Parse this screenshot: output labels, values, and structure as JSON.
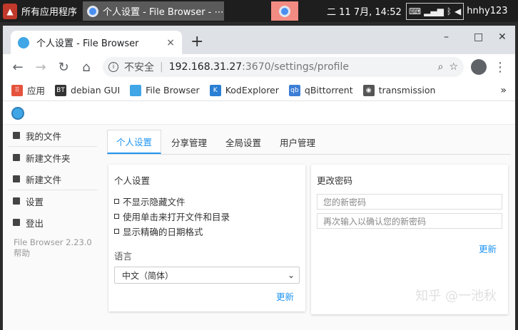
{
  "panel": {
    "apps_label": "所有应用程序",
    "task_title": "个人设置 - File Browser - ⋯",
    "clock": "二 11 7月, 14:52",
    "user": "hnhy123"
  },
  "browser": {
    "tab_title": "个人设置 - File Browser",
    "tab_close": "×",
    "new_tab": "+",
    "win_min": "–",
    "win_max": "□",
    "win_close": "✕",
    "not_secure": "不安全",
    "url_host": "192.168.31.27",
    "url_path": ":3670/settings/profile"
  },
  "bookmarks": [
    {
      "label": "应用",
      "icon": "apps-grid-icon",
      "color": "#e5533d",
      "glyph": "⠿"
    },
    {
      "label": "debian GUI",
      "icon": "bt-icon",
      "color": "#333333",
      "glyph": "BT"
    },
    {
      "label": "File Browser",
      "icon": "filebrowser-icon",
      "color": "#40a6e6",
      "glyph": ""
    },
    {
      "label": "KodExplorer",
      "icon": "kod-icon",
      "color": "#2a7fd4",
      "glyph": "K"
    },
    {
      "label": "qBittorrent",
      "icon": "qbittorrent-icon",
      "color": "#3c7ed6",
      "glyph": "qb"
    },
    {
      "label": "transmission",
      "icon": "globe-icon",
      "color": "#555555",
      "glyph": "◉"
    }
  ],
  "sidebar": {
    "items": [
      {
        "label": "我的文件",
        "icon": "folder-icon"
      },
      {
        "label": "新建文件夹",
        "icon": "folder-plus-icon"
      },
      {
        "label": "新建文件",
        "icon": "file-plus-icon"
      },
      {
        "label": "设置",
        "icon": "settings-icon"
      },
      {
        "label": "登出",
        "icon": "logout-icon"
      }
    ],
    "version": "File Browser 2.23.0",
    "help": "帮助"
  },
  "tabs": [
    {
      "label": "个人设置",
      "active": true
    },
    {
      "label": "分享管理",
      "active": false
    },
    {
      "label": "全局设置",
      "active": false
    },
    {
      "label": "用户管理",
      "active": false
    }
  ],
  "profile": {
    "title": "个人设置",
    "options": [
      "不显示隐藏文件",
      "使用单击来打开文件和目录",
      "显示精确的日期格式"
    ],
    "lang_label": "语言",
    "lang_value": "中文（简体）",
    "update": "更新"
  },
  "password": {
    "title": "更改密码",
    "new_placeholder": "您的新密码",
    "confirm_placeholder": "再次输入以确认您的新密码",
    "update": "更新"
  },
  "watermark": "知乎 @一池秋",
  "colors": {
    "accent": "#2196f3",
    "active_task": "#f28b82"
  }
}
